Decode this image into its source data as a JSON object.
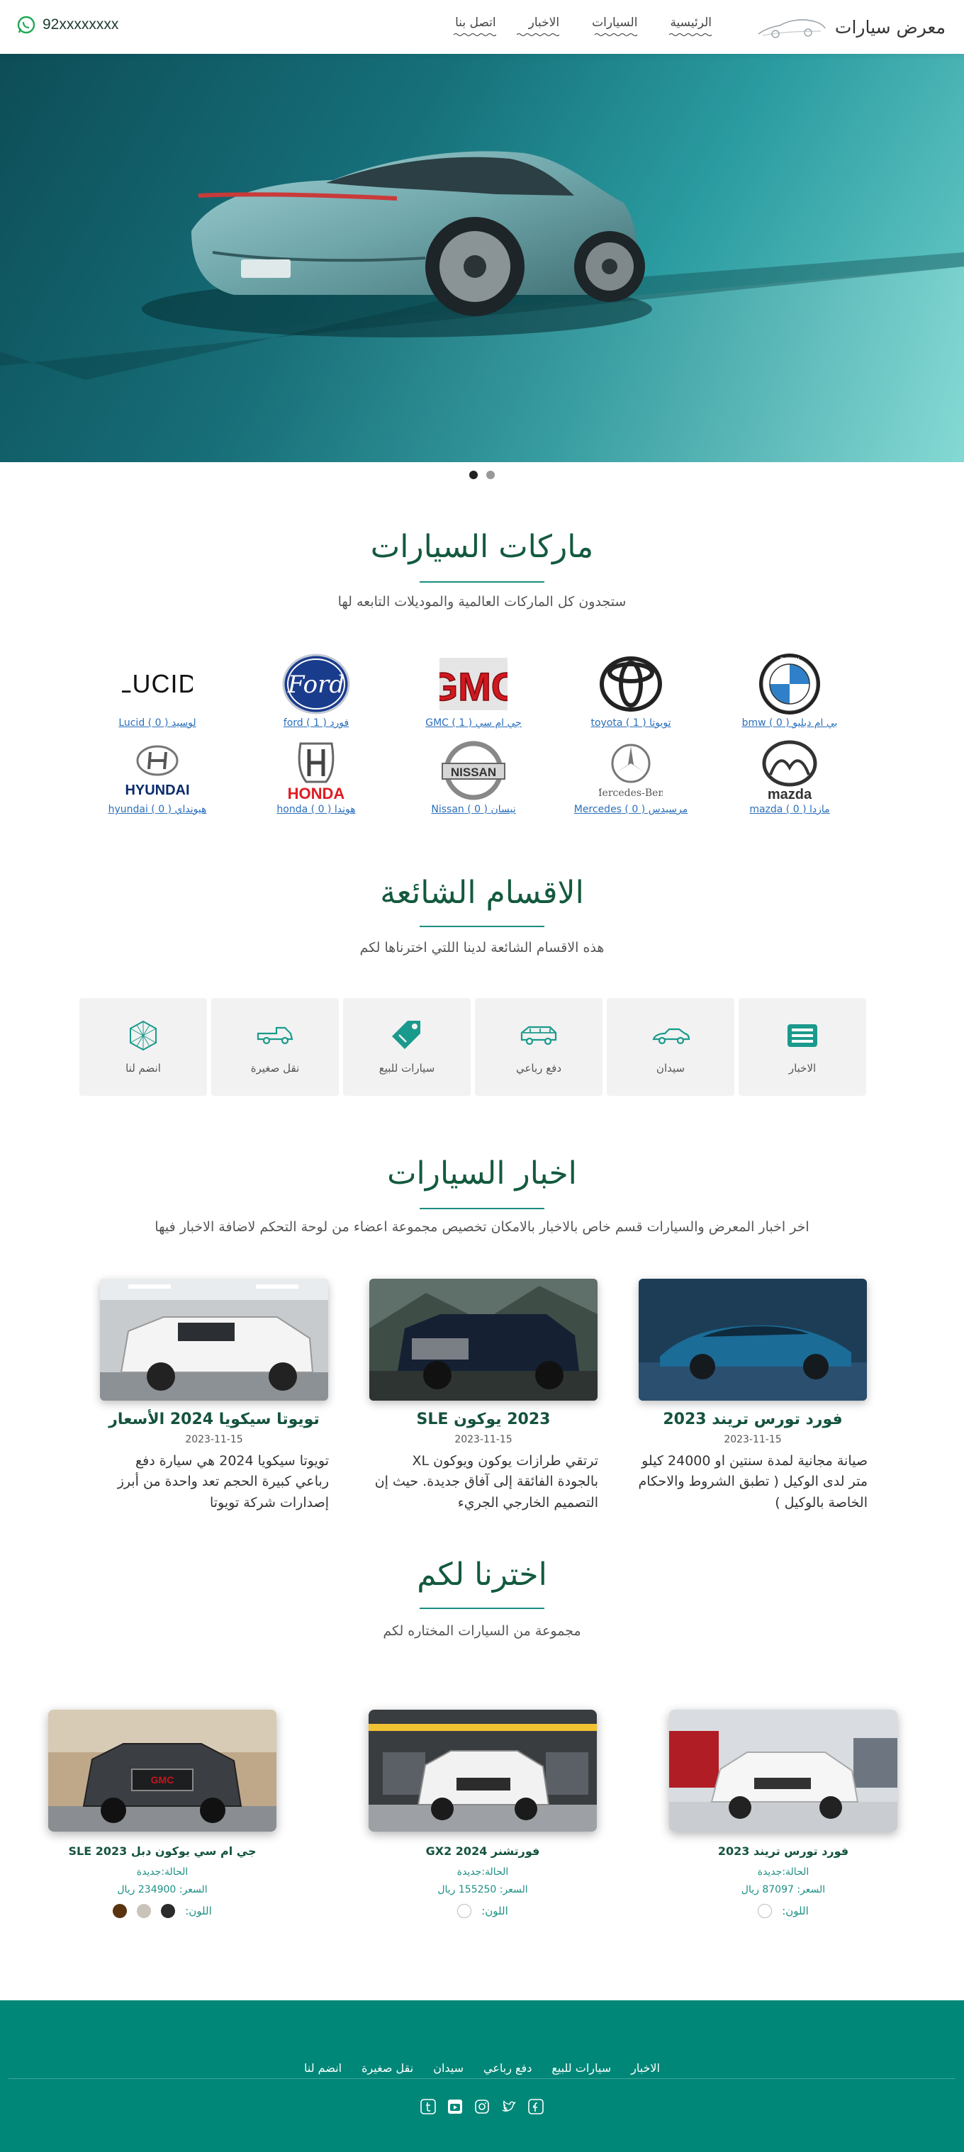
{
  "header": {
    "brand": "معرض سيارات",
    "nav": [
      "الرئيسية",
      "السيارات",
      "الاخبار",
      "اتصل بنا"
    ],
    "phone": "92xxxxxxxx"
  },
  "hero": {
    "slides": 2,
    "active_slide": 1
  },
  "brands_section": {
    "title": "ماركات السيارات",
    "subtitle": "ستجدون كل الماركات العالمية والموديلات التابعه لها",
    "items": [
      {
        "label": "بي ام دبليو ( 0 ) bmw",
        "logo": "bmw-logo"
      },
      {
        "label": "تويوتا ( 1 ) toyota",
        "logo": "toyota-logo"
      },
      {
        "label": "جي ام سي ( 1 ) GMC",
        "logo": "gmc-logo"
      },
      {
        "label": "فورد ( 1 ) ford",
        "logo": "ford-logo"
      },
      {
        "label": "لوسيد ( 0 ) Lucid",
        "logo": "lucid-logo"
      },
      {
        "label": "مازدا ( 0 ) mazda",
        "logo": "mazda-logo"
      },
      {
        "label": "مرسيدس ( 0 ) Mercedes",
        "logo": "mercedes-logo"
      },
      {
        "label": "نيسان ( 0 ) Nissan",
        "logo": "nissan-logo"
      },
      {
        "label": "هوندا ( 0 ) honda",
        "logo": "honda-logo"
      },
      {
        "label": "هيونداي ( 0 ) hyundai",
        "logo": "hyundai-logo"
      }
    ]
  },
  "categories_section": {
    "title": "الاقسام الشائعة",
    "subtitle": "هذه الاقسام الشائعة لدينا اللتي اخترناها لكم",
    "items": [
      {
        "label": "الاخبار",
        "icon": "newspaper-icon"
      },
      {
        "label": "سيدان",
        "icon": "sedan-car-icon"
      },
      {
        "label": "دفع رباعي",
        "icon": "suv-car-icon"
      },
      {
        "label": "سيارات للبيع",
        "icon": "price-tag-icon"
      },
      {
        "label": "نقل صغيرة",
        "icon": "pickup-truck-icon"
      },
      {
        "label": "انضم لنا",
        "icon": "hexagon-network-icon"
      }
    ]
  },
  "news_section": {
    "title": "اخبار السيارات",
    "subtitle": "اخر اخبار المعرض والسيارات قسم خاص بالاخبار بالامكان تخصيص مجموعة اعضاء من لوحة التحكم لاضافة الاخبار فيها",
    "items": [
      {
        "title": "فورد تورس تريند 2023",
        "date": "2023-11-15",
        "body": "صيانة مجانية لمدة سنتين او 24000 كيلو متر لدى الوكيل ( تطبق الشروط والاحكام الخاصة بالوكيل )"
      },
      {
        "title": "2023 يوكون SLE",
        "date": "2023-11-15",
        "body": "ترتقي طرازات يوكون ويوكون XL بالجودة الفائقة إلى آفاق جديدة. حيث إن التصميم الخارجي الجريء"
      },
      {
        "title": "تويوتا سيكويا 2024 الأسعار",
        "date": "2023-11-15",
        "body": "تويوتا سيكويا 2024 هي سيارة دفع رباعي كبيرة الحجم تعد واحدة من أبرز إصدارات شركة تويوتا"
      }
    ]
  },
  "chosen_section": {
    "title": "اخترنا لكم",
    "subtitle": "مجموعة من السيارات المختاره لكم",
    "colors_label": "اللون:",
    "items": [
      {
        "title": "فورد تورس تريند 2023",
        "condition": "الحالة:جديدة",
        "price": "السعر: 87097 ريال",
        "colors": [
          "#ffffff"
        ]
      },
      {
        "title": "فورتشنر 2024 GX2",
        "condition": "الحالة:جديدة",
        "price": "السعر: 155250 ريال",
        "colors": [
          "#ffffff"
        ]
      },
      {
        "title": "جي ام سي يوكون دبل SLE 2023",
        "condition": "الحالة:جديدة",
        "price": "السعر: 234900 ريال",
        "colors": [
          "#2b2b2b",
          "#c9c3ba",
          "#5a3410"
        ]
      }
    ]
  },
  "footer": {
    "links": [
      "الاخبار",
      "سيارات للبيع",
      "دفع رباعي",
      "سيدان",
      "نقل صغيرة",
      "انضم لنا"
    ],
    "social": [
      "facebook-icon",
      "twitter-icon",
      "instagram-icon",
      "youtube-icon",
      "tumblr-icon"
    ]
  },
  "colors": {
    "accent": "#008778",
    "heading": "#135a3e",
    "link": "#2a6fbb"
  }
}
